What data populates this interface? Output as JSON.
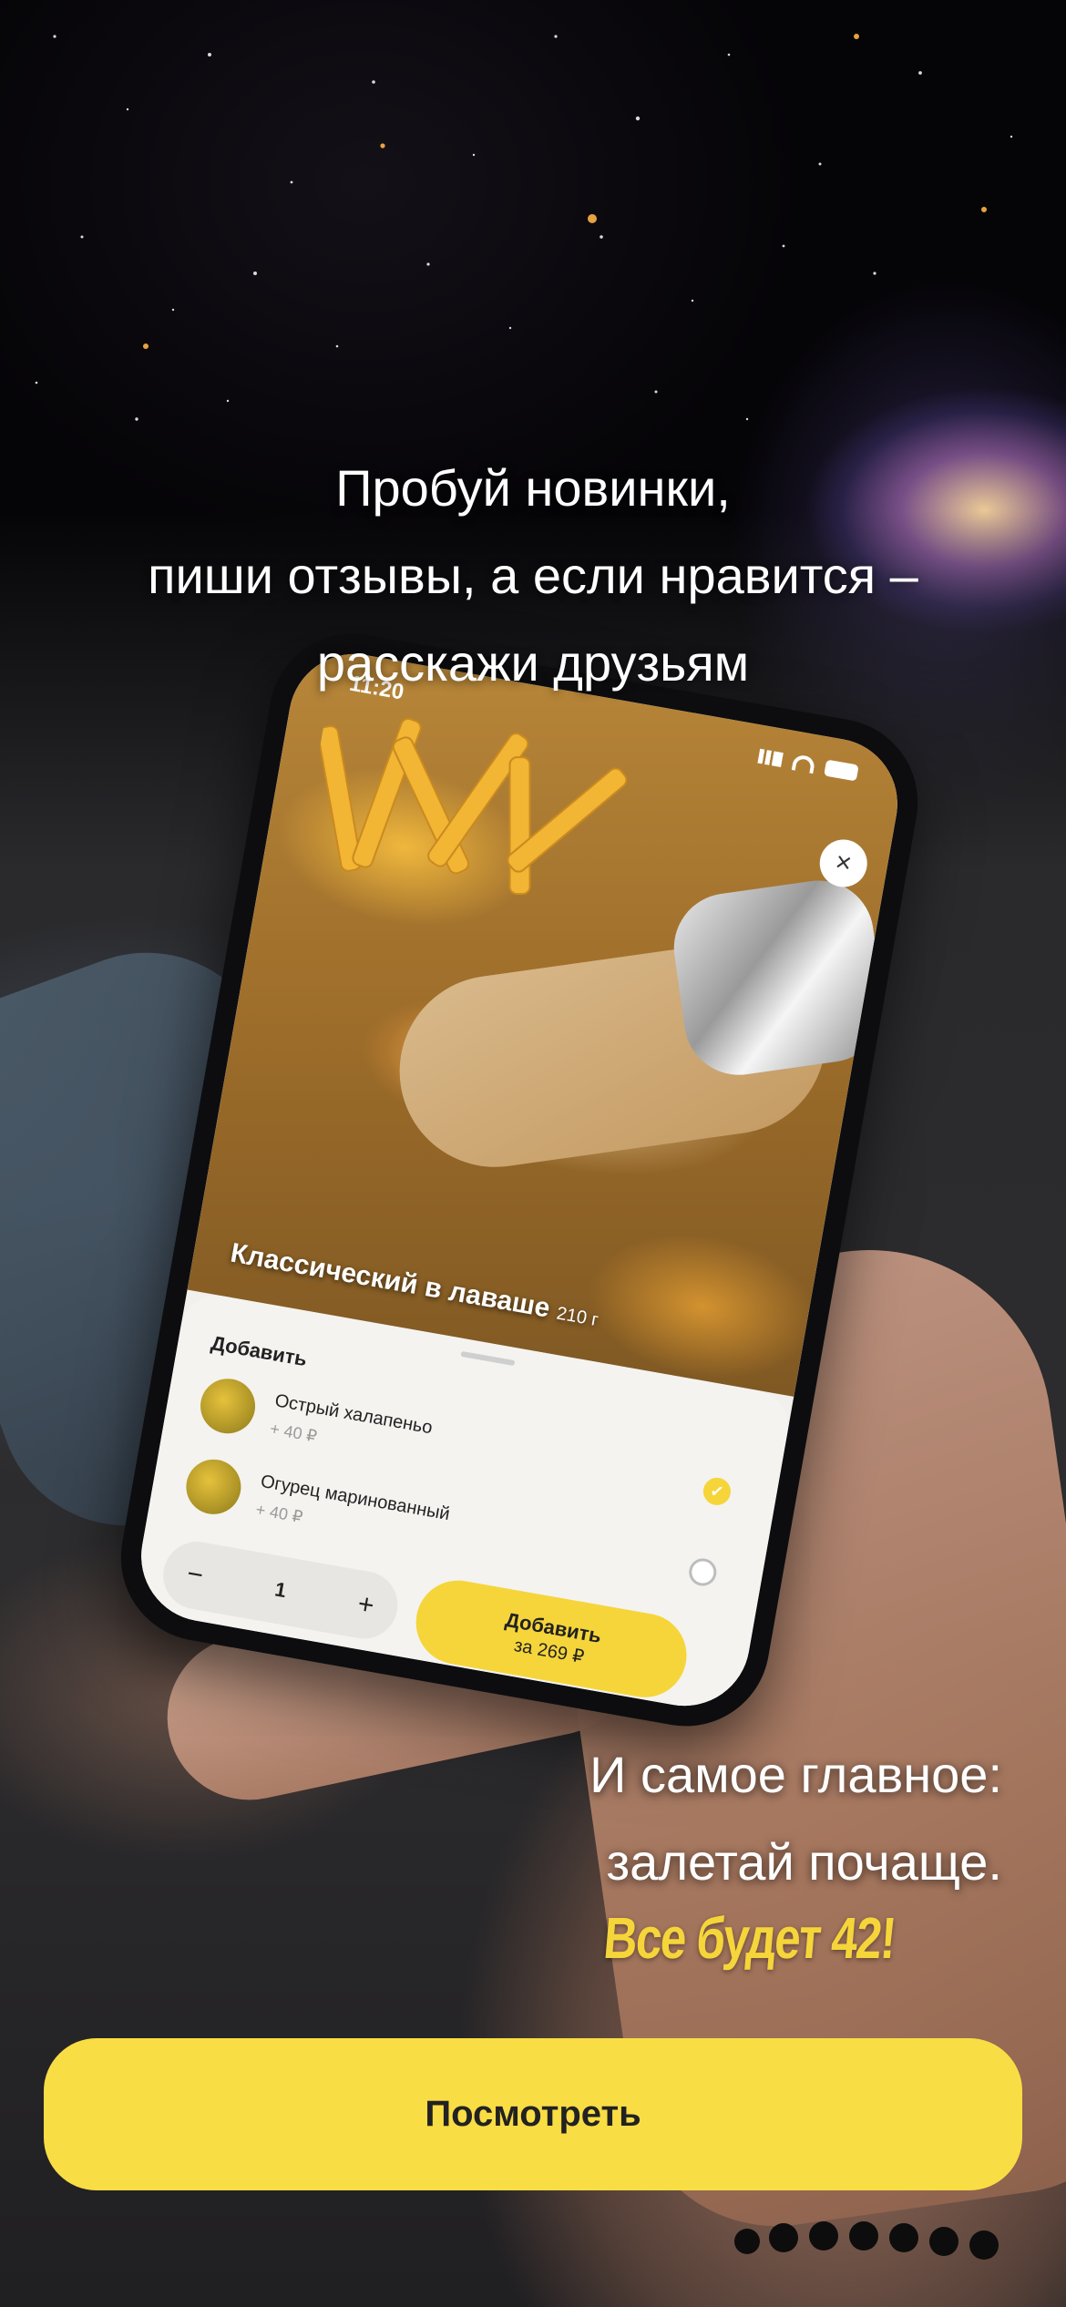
{
  "promo": {
    "headline_lines": [
      "Пробуй новинки,",
      "пиши отзывы, а если нравится –",
      "расскажи друзьям"
    ],
    "closing_lines": [
      "И самое главное:",
      "залетай почаще."
    ],
    "slogan": "Все будет 42!"
  },
  "phone_mockup": {
    "status_time": "11:20",
    "product": {
      "name": "Классический в лаваше",
      "weight": "210 г"
    },
    "sheet_title": "Добавить",
    "addons": [
      {
        "name": "Острый халапеньо",
        "price": "+ 40 ₽",
        "selected": true
      },
      {
        "name": "Огурец маринованный",
        "price": "+ 40 ₽",
        "selected": false
      }
    ],
    "quantity": "1",
    "minus": "−",
    "plus": "+",
    "close_icon": "×",
    "add_button": {
      "label": "Добавить",
      "price": "за 269 ₽"
    }
  },
  "cta": {
    "label": "Посмотреть"
  },
  "colors": {
    "accent": "#F9DD44",
    "slogan": "#F5D53A"
  }
}
